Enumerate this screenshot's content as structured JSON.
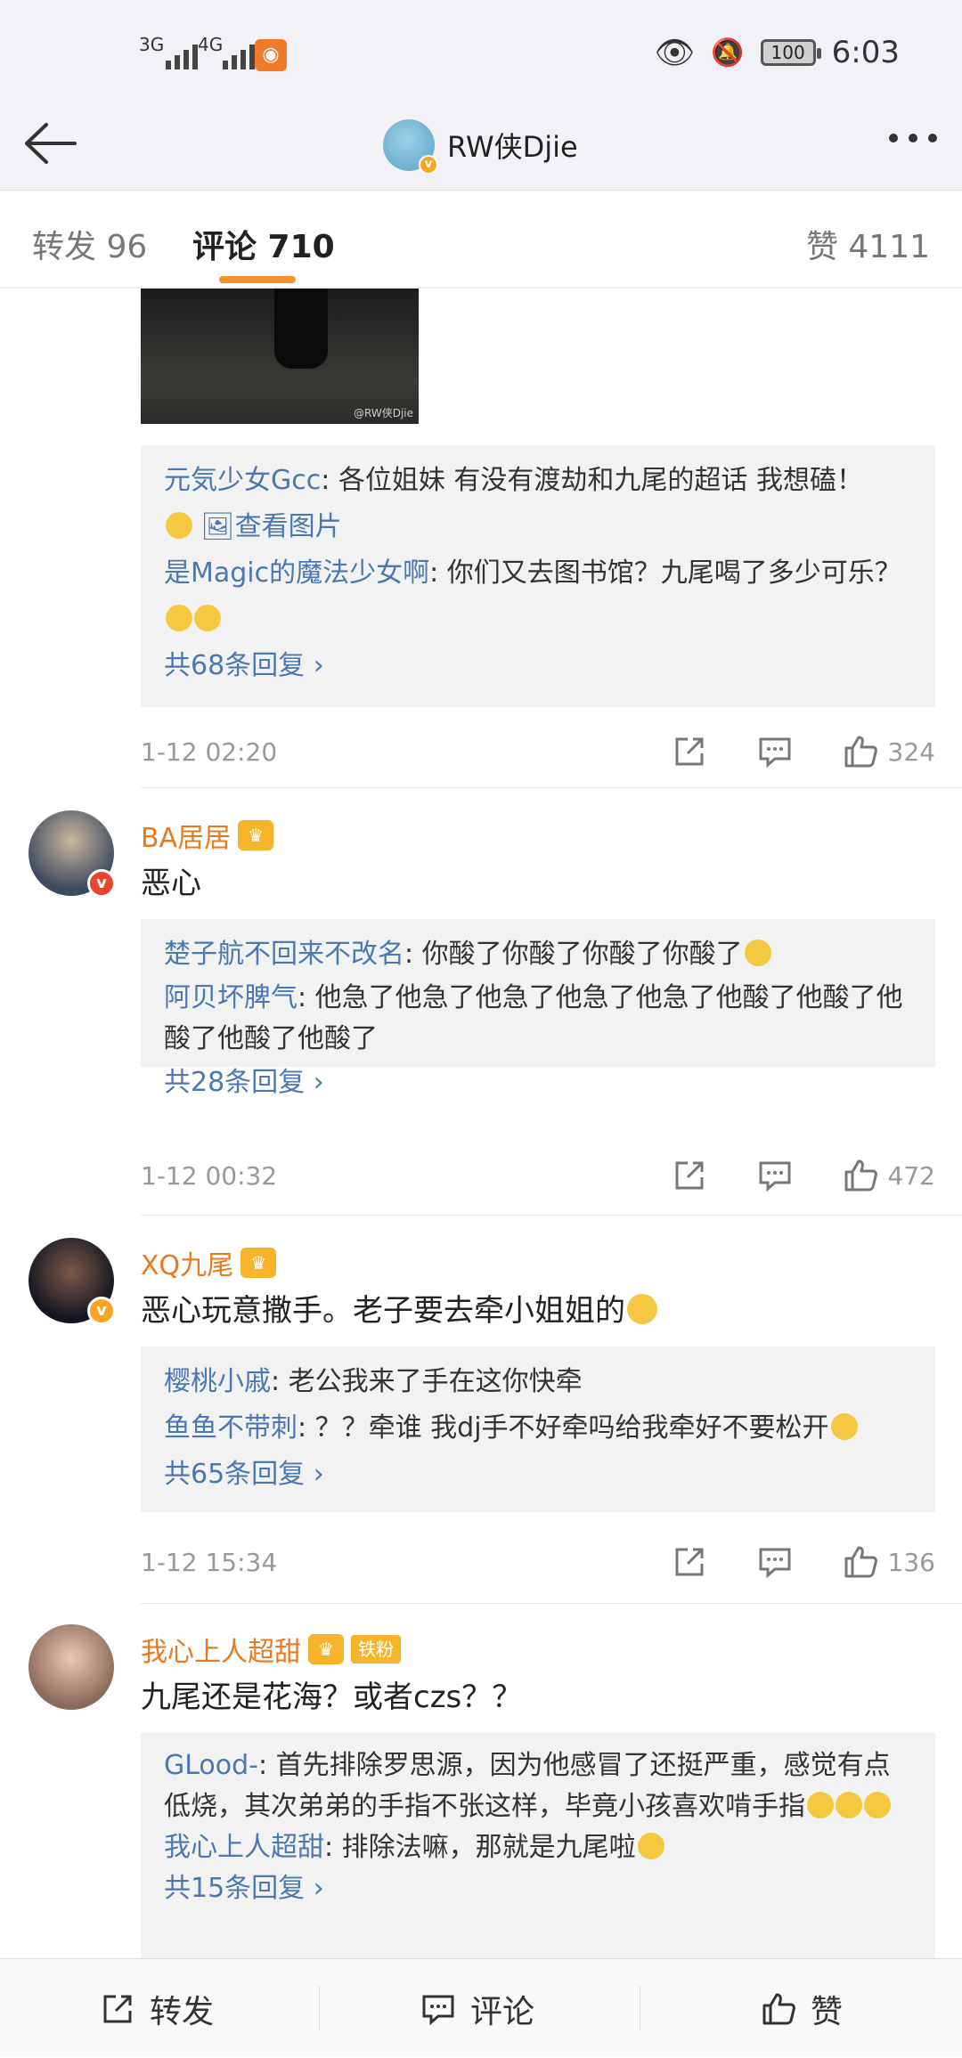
{
  "status_bar": {
    "signal1": "3G",
    "signal2": "4G",
    "battery": "100",
    "time": "6:03"
  },
  "nav": {
    "title": "RW侠Djie"
  },
  "tabs": [
    {
      "label": "转发 96"
    },
    {
      "label": "评论 710"
    },
    {
      "label": "赞 4111"
    }
  ],
  "photo": {
    "watermark": "@RW侠Djie"
  },
  "comments": [
    {
      "replies": [
        {
          "name": "元気少女Gcc",
          "text": ": 各位姐妹 有没有渡劫和九尾的超话 我想磕！",
          "line2": "查看图片"
        },
        {
          "name": "是Magic的魔法少女啊",
          "text": ": 你们又去图书馆？九尾喝了多少可乐？"
        }
      ],
      "more": "共68条回复 ›",
      "time": "1-12 02:20",
      "likes": "324"
    },
    {
      "user": "BA居居",
      "content": "恶心",
      "replies": [
        {
          "name": "楚子航不回来不改名",
          "text": ": 你酸了你酸了你酸了你酸了"
        },
        {
          "name": "阿贝坏脾气",
          "text": ": 他急了他急了他急了他急了他急了他酸了他酸了他酸了他酸了他酸了"
        }
      ],
      "more": "共28条回复 ›",
      "time": "1-12 00:32",
      "likes": "472"
    },
    {
      "user": "XQ九尾",
      "content": "恶心玩意撒手。老子要去牵小姐姐的",
      "replies": [
        {
          "name": "樱桃小戚",
          "text": ": 老公我来了手在这你快牵"
        },
        {
          "name": "鱼鱼不带刺",
          "text": ": ？？牵谁 我dj手不好牵吗给我牵好不要松开"
        }
      ],
      "more": "共65条回复 ›",
      "time": "1-12 15:34",
      "likes": "136"
    },
    {
      "user": "我心上人超甜",
      "badge": "铁粉",
      "content": "九尾还是花海？或者czs？？",
      "replies": [
        {
          "name": "GLood-",
          "text": ": 首先排除罗思源，因为他感冒了还挺严重，感觉有点低烧，其次弟弟的手指不张这样，毕竟小孩喜欢啃手指"
        },
        {
          "name": "我心上人超甜",
          "text": ": 排除法嘛，那就是九尾啦"
        }
      ],
      "more": "共15条回复 ›"
    }
  ],
  "bottom_bar": {
    "repost": "转发",
    "comment": "评论",
    "like": "赞"
  },
  "colors": {
    "accent": "#f5922e",
    "link": "#4b78b0",
    "username": "#e8791f",
    "reply_bg": "#f2f2f2"
  },
  "icons": [
    "back-arrow-icon",
    "more-dots-icon",
    "repost-icon",
    "comment-icon",
    "like-icon",
    "crown-icon",
    "verified-icon",
    "eye-icon",
    "mute-bell-icon"
  ]
}
